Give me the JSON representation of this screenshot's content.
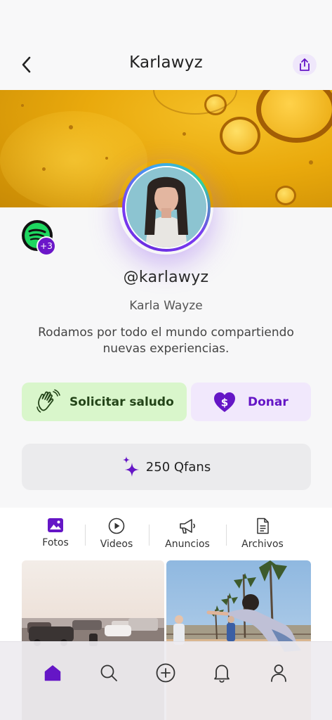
{
  "header": {
    "title": "Karlawyz",
    "back_icon": "chevron-left-icon",
    "share_icon": "share-icon"
  },
  "profile": {
    "username": "@karlawyz",
    "full_name": "Karla Wayze",
    "bio": "Rodamos por todo el mundo compartiendo nuevas experiencias.",
    "social_icon": "spotify-icon",
    "extra_socials": "+3"
  },
  "actions": {
    "greet_label": "Solicitar saludo",
    "greet_icon": "waving-hand-icon",
    "donate_label": "Donar",
    "donate_icon": "heart-dollar-icon"
  },
  "qfans": {
    "label": "250 Qfans",
    "icon": "sparkles-icon"
  },
  "tabs": [
    {
      "label": "Fotos",
      "icon": "image-icon",
      "active": true
    },
    {
      "label": "Videos",
      "icon": "play-circle-icon",
      "active": false
    },
    {
      "label": "Anuncios",
      "icon": "megaphone-icon",
      "active": false
    },
    {
      "label": "Archivos",
      "icon": "document-icon",
      "active": false
    }
  ],
  "bottom_nav": [
    {
      "name": "home",
      "icon": "home-icon",
      "active": true
    },
    {
      "name": "search",
      "icon": "search-icon",
      "active": false
    },
    {
      "name": "create",
      "icon": "plus-circle-icon",
      "active": false
    },
    {
      "name": "notifications",
      "icon": "bell-icon",
      "active": false
    },
    {
      "name": "profile",
      "icon": "user-icon",
      "active": false
    }
  ],
  "colors": {
    "accent": "#6516c6",
    "greet_bg": "#d9f6cb",
    "donate_bg": "#f1e8fc",
    "spotify": "#1ed760"
  }
}
